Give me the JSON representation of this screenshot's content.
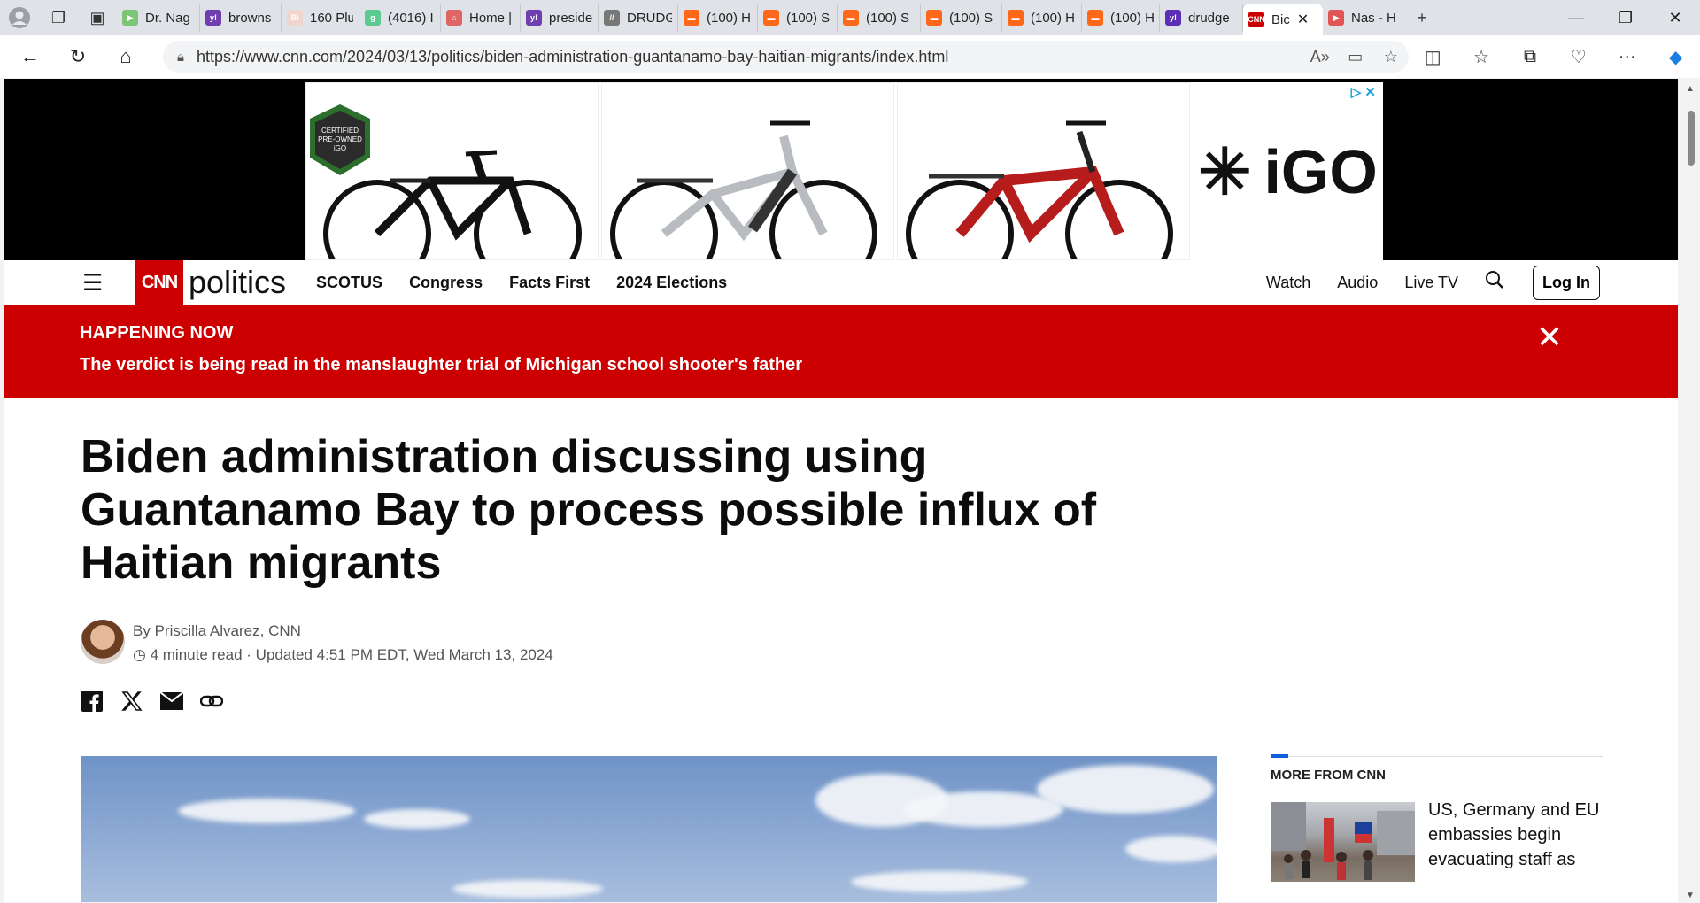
{
  "browser": {
    "tabs": [
      {
        "label": "Dr. Nag",
        "fav_color": "#7cc576",
        "fav": "▶"
      },
      {
        "label": "browns",
        "fav_color": "#6f3fb0",
        "fav": "y!"
      },
      {
        "label": "160 Plu",
        "fav_color": "#f0d5cf",
        "fav": "BI"
      },
      {
        "label": "(4016) I",
        "fav_color": "#5cc98e",
        "fav": "g"
      },
      {
        "label": "Home |",
        "fav_color": "#e06666",
        "fav": "⌂"
      },
      {
        "label": "preside",
        "fav_color": "#6f3fb0",
        "fav": "y!"
      },
      {
        "label": "DRUDG",
        "fav_color": "#777777",
        "fav": "//"
      },
      {
        "label": "(100) H",
        "fav_color": "#ff6719",
        "fav": "▬"
      },
      {
        "label": "(100) S",
        "fav_color": "#ff6719",
        "fav": "▬"
      },
      {
        "label": "(100) S",
        "fav_color": "#ff6719",
        "fav": "▬"
      },
      {
        "label": "(100) S",
        "fav_color": "#ff6719",
        "fav": "▬"
      },
      {
        "label": "(100) H",
        "fav_color": "#ff6719",
        "fav": "▬"
      },
      {
        "label": "(100) H",
        "fav_color": "#ff6719",
        "fav": "▬"
      },
      {
        "label": "drudge",
        "fav_color": "#5b2fb5",
        "fav": "y!"
      },
      {
        "label": "Bic",
        "fav_color": "#cc0000",
        "fav": "CNN",
        "active": true
      },
      {
        "label": "Nas - H",
        "fav_color": "#e05555",
        "fav": "▶"
      }
    ],
    "new_tab": "+",
    "url": "https://www.cnn.com/2024/03/13/politics/biden-administration-guantanamo-bay-haitian-migrants/index.html"
  },
  "ad": {
    "brand": "iGO",
    "badge_line1": "CERTIFIED",
    "badge_line2": "PRE-OWNED",
    "badge_line3": "iGO",
    "adchoices": "▷ ✕"
  },
  "header": {
    "logo": "CNN",
    "section": "politics",
    "nav": [
      "SCOTUS",
      "Congress",
      "Facts First",
      "2024 Elections"
    ],
    "right_nav": [
      "Watch",
      "Audio",
      "Live TV"
    ],
    "login": "Log In"
  },
  "banner": {
    "tag": "HAPPENING NOW",
    "text": "The verdict is being read in the manslaughter trial of Michigan school shooter's father"
  },
  "article": {
    "headline": "Biden administration discussing using Guantanamo Bay to process possible influx of Haitian migrants",
    "by_prefix": "By",
    "author": "Priscilla Alvarez",
    "outlet": ", CNN",
    "read_time": "4 minute read",
    "updated": "Updated 4:51 PM EDT, Wed March 13, 2024"
  },
  "sidebar": {
    "title": "MORE FROM CNN",
    "story": "US, Germany and EU embassies begin evacuating staff as"
  }
}
